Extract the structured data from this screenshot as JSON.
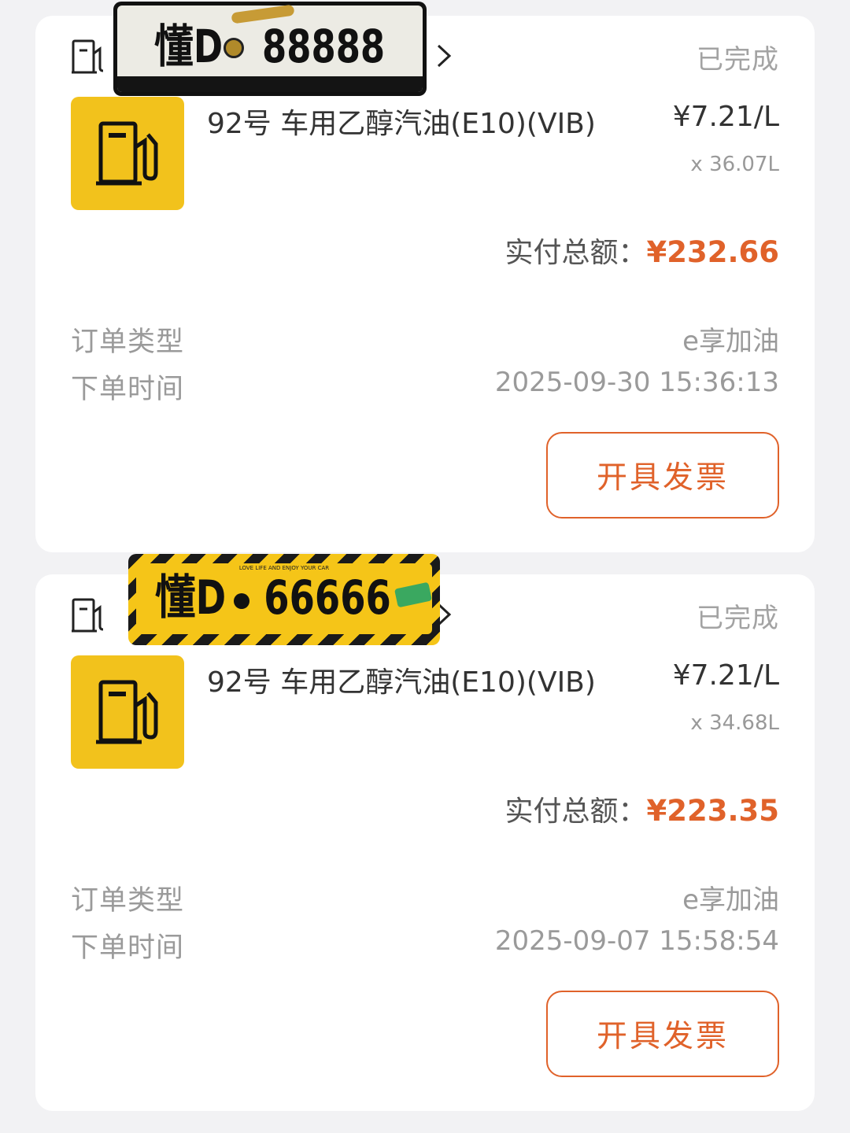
{
  "orders": [
    {
      "status": "已完成",
      "product_name": "92号 车用乙醇汽油(E10)(VIB)",
      "unit_price": "¥7.21/L",
      "quantity": "x 36.07L",
      "total_label": "实付总额：",
      "total_amount": "¥232.66",
      "order_type_label": "订单类型",
      "order_type_value": "e享加油",
      "order_time_label": "下单时间",
      "order_time_value": "2025-09-30 15:36:13",
      "invoice_button_label": "开具发票"
    },
    {
      "status": "已完成",
      "product_name": "92号 车用乙醇汽油(E10)(VIB)",
      "unit_price": "¥7.21/L",
      "quantity": "x 34.68L",
      "total_label": "实付总额：",
      "total_amount": "¥223.35",
      "order_type_label": "订单类型",
      "order_type_value": "e享加油",
      "order_time_label": "下单时间",
      "order_time_value": "2025-09-07 15:58:54",
      "invoice_button_label": "开具发票"
    }
  ],
  "plates": [
    {
      "prefix": "懂D",
      "number": "88888"
    },
    {
      "prefix": "懂D",
      "number": "66666",
      "tagline": "LOVE LIFE AND ENJOY YOUR CAR"
    }
  ],
  "colors": {
    "accent": "#e0622a",
    "product_thumb": "#f2c21c",
    "status_text": "#a3a3a3",
    "background": "#f2f2f4"
  },
  "icons": {
    "station": "fuel-station-icon",
    "product": "fuel-pump-icon",
    "chevron": "chevron-right-icon"
  }
}
